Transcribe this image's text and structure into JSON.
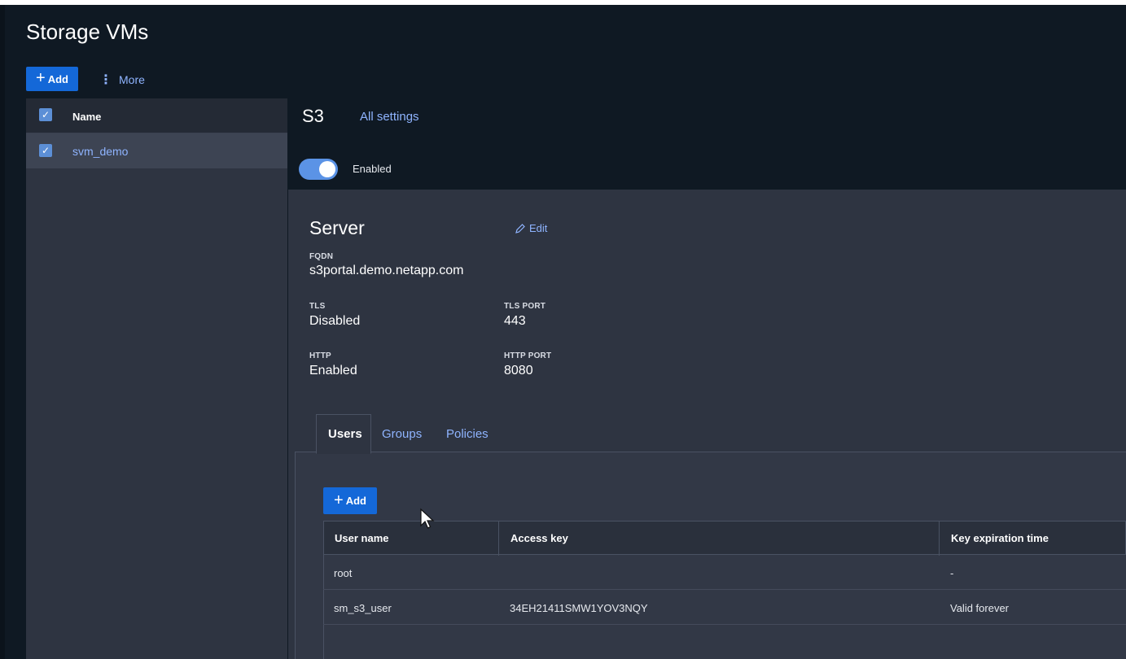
{
  "page": {
    "title": "Storage VMs"
  },
  "toolbar": {
    "add_label": "Add",
    "more_label": "More"
  },
  "svm_list": {
    "header": "Name",
    "rows": [
      {
        "name": "svm_demo",
        "checked": true
      }
    ]
  },
  "s3": {
    "title": "S3",
    "all_settings_link": "All settings",
    "toggle_label": "Enabled",
    "toggle_on": true
  },
  "server": {
    "title": "Server",
    "edit_label": "Edit",
    "fqdn_label": "FQDN",
    "fqdn_value": "s3portal.demo.netapp.com",
    "tls_label": "TLS",
    "tls_value": "Disabled",
    "tls_port_label": "TLS PORT",
    "tls_port_value": "443",
    "http_label": "HTTP",
    "http_value": "Enabled",
    "http_port_label": "HTTP PORT",
    "http_port_value": "8080"
  },
  "tabs": [
    {
      "label": "Users",
      "active": true
    },
    {
      "label": "Groups",
      "active": false
    },
    {
      "label": "Policies",
      "active": false
    }
  ],
  "users": {
    "add_label": "Add",
    "columns": [
      "User name",
      "Access key",
      "Key expiration time"
    ],
    "rows": [
      [
        "root",
        "",
        "-"
      ],
      [
        "sm_s3_user",
        "34EH21411SMW1YOV3NQY",
        "Valid forever"
      ]
    ]
  },
  "colors": {
    "background": "#0f1923",
    "panel": "#2e3441",
    "primary_button": "#1468d8",
    "link": "#8fb4ff",
    "toggle_on": "#5b93e6"
  },
  "icons": [
    "plus-icon",
    "more-vertical-icon",
    "checkbox-checked-icon",
    "pencil-icon",
    "mouse-pointer-icon"
  ]
}
